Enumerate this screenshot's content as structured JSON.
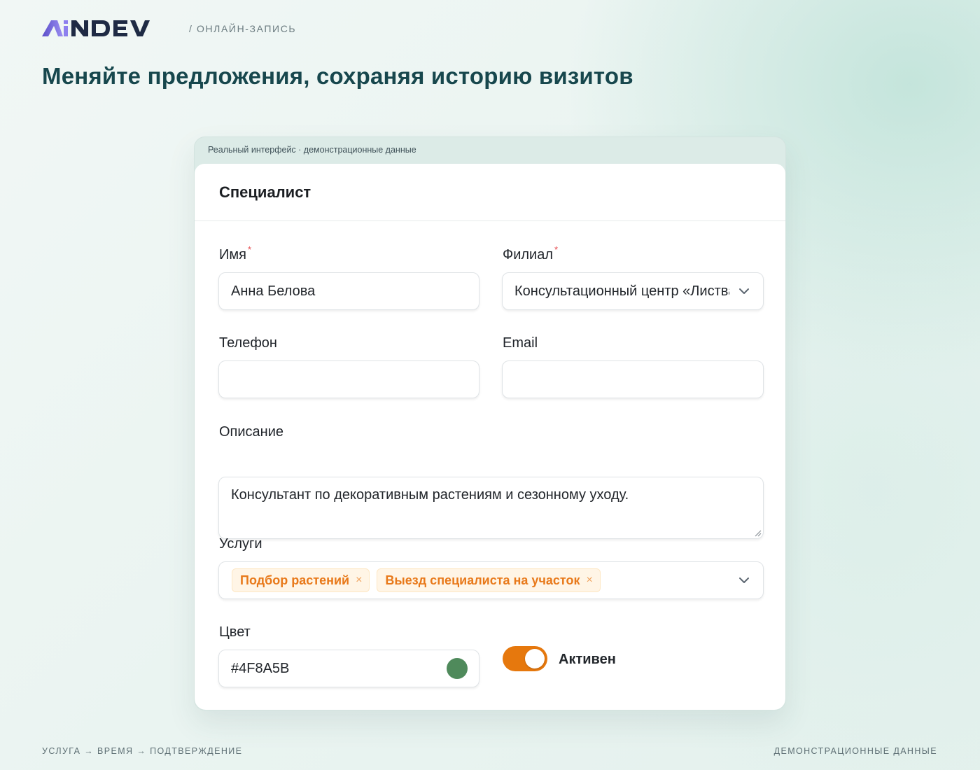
{
  "brand": {
    "logo_text": "AiNDEV",
    "breadcrumb": "/ ОНЛАЙН-ЗАПИСЬ"
  },
  "headline": "Меняйте предложения, сохраняя историю визитов",
  "frame": {
    "note": "Реальный интерфейс · демонстрационные данные"
  },
  "form": {
    "title": "Специалист",
    "name": {
      "label": "Имя",
      "required_mark": "*",
      "value": "Анна Белова"
    },
    "branch": {
      "label": "Филиал",
      "required_mark": "*",
      "value": "Консультационный центр «Листва»"
    },
    "phone": {
      "label": "Телефон",
      "value": ""
    },
    "email": {
      "label": "Email",
      "value": ""
    },
    "description": {
      "label": "Описание",
      "value": "Консультант по декоративным растениям и сезонному уходу."
    },
    "services": {
      "label": "Услуги",
      "tags": [
        "Подбор растений",
        "Выезд специалиста на участок"
      ],
      "remove_glyph": "×"
    },
    "color": {
      "label": "Цвет",
      "value": "#4F8A5B",
      "swatch": "#4F8A5B"
    },
    "active": {
      "label": "Активен",
      "on": true
    }
  },
  "footer": {
    "left": "УСЛУГА → ВРЕМЯ → ПОДТВЕРЖДЕНИЕ",
    "right": "ДЕМОНСТРАЦИОННЫЕ ДАННЫЕ"
  },
  "colors": {
    "accent": "#E6780D",
    "headline": "#17474D",
    "logo_gradient": [
      "#6A5ACD",
      "#9A8CF0"
    ]
  }
}
